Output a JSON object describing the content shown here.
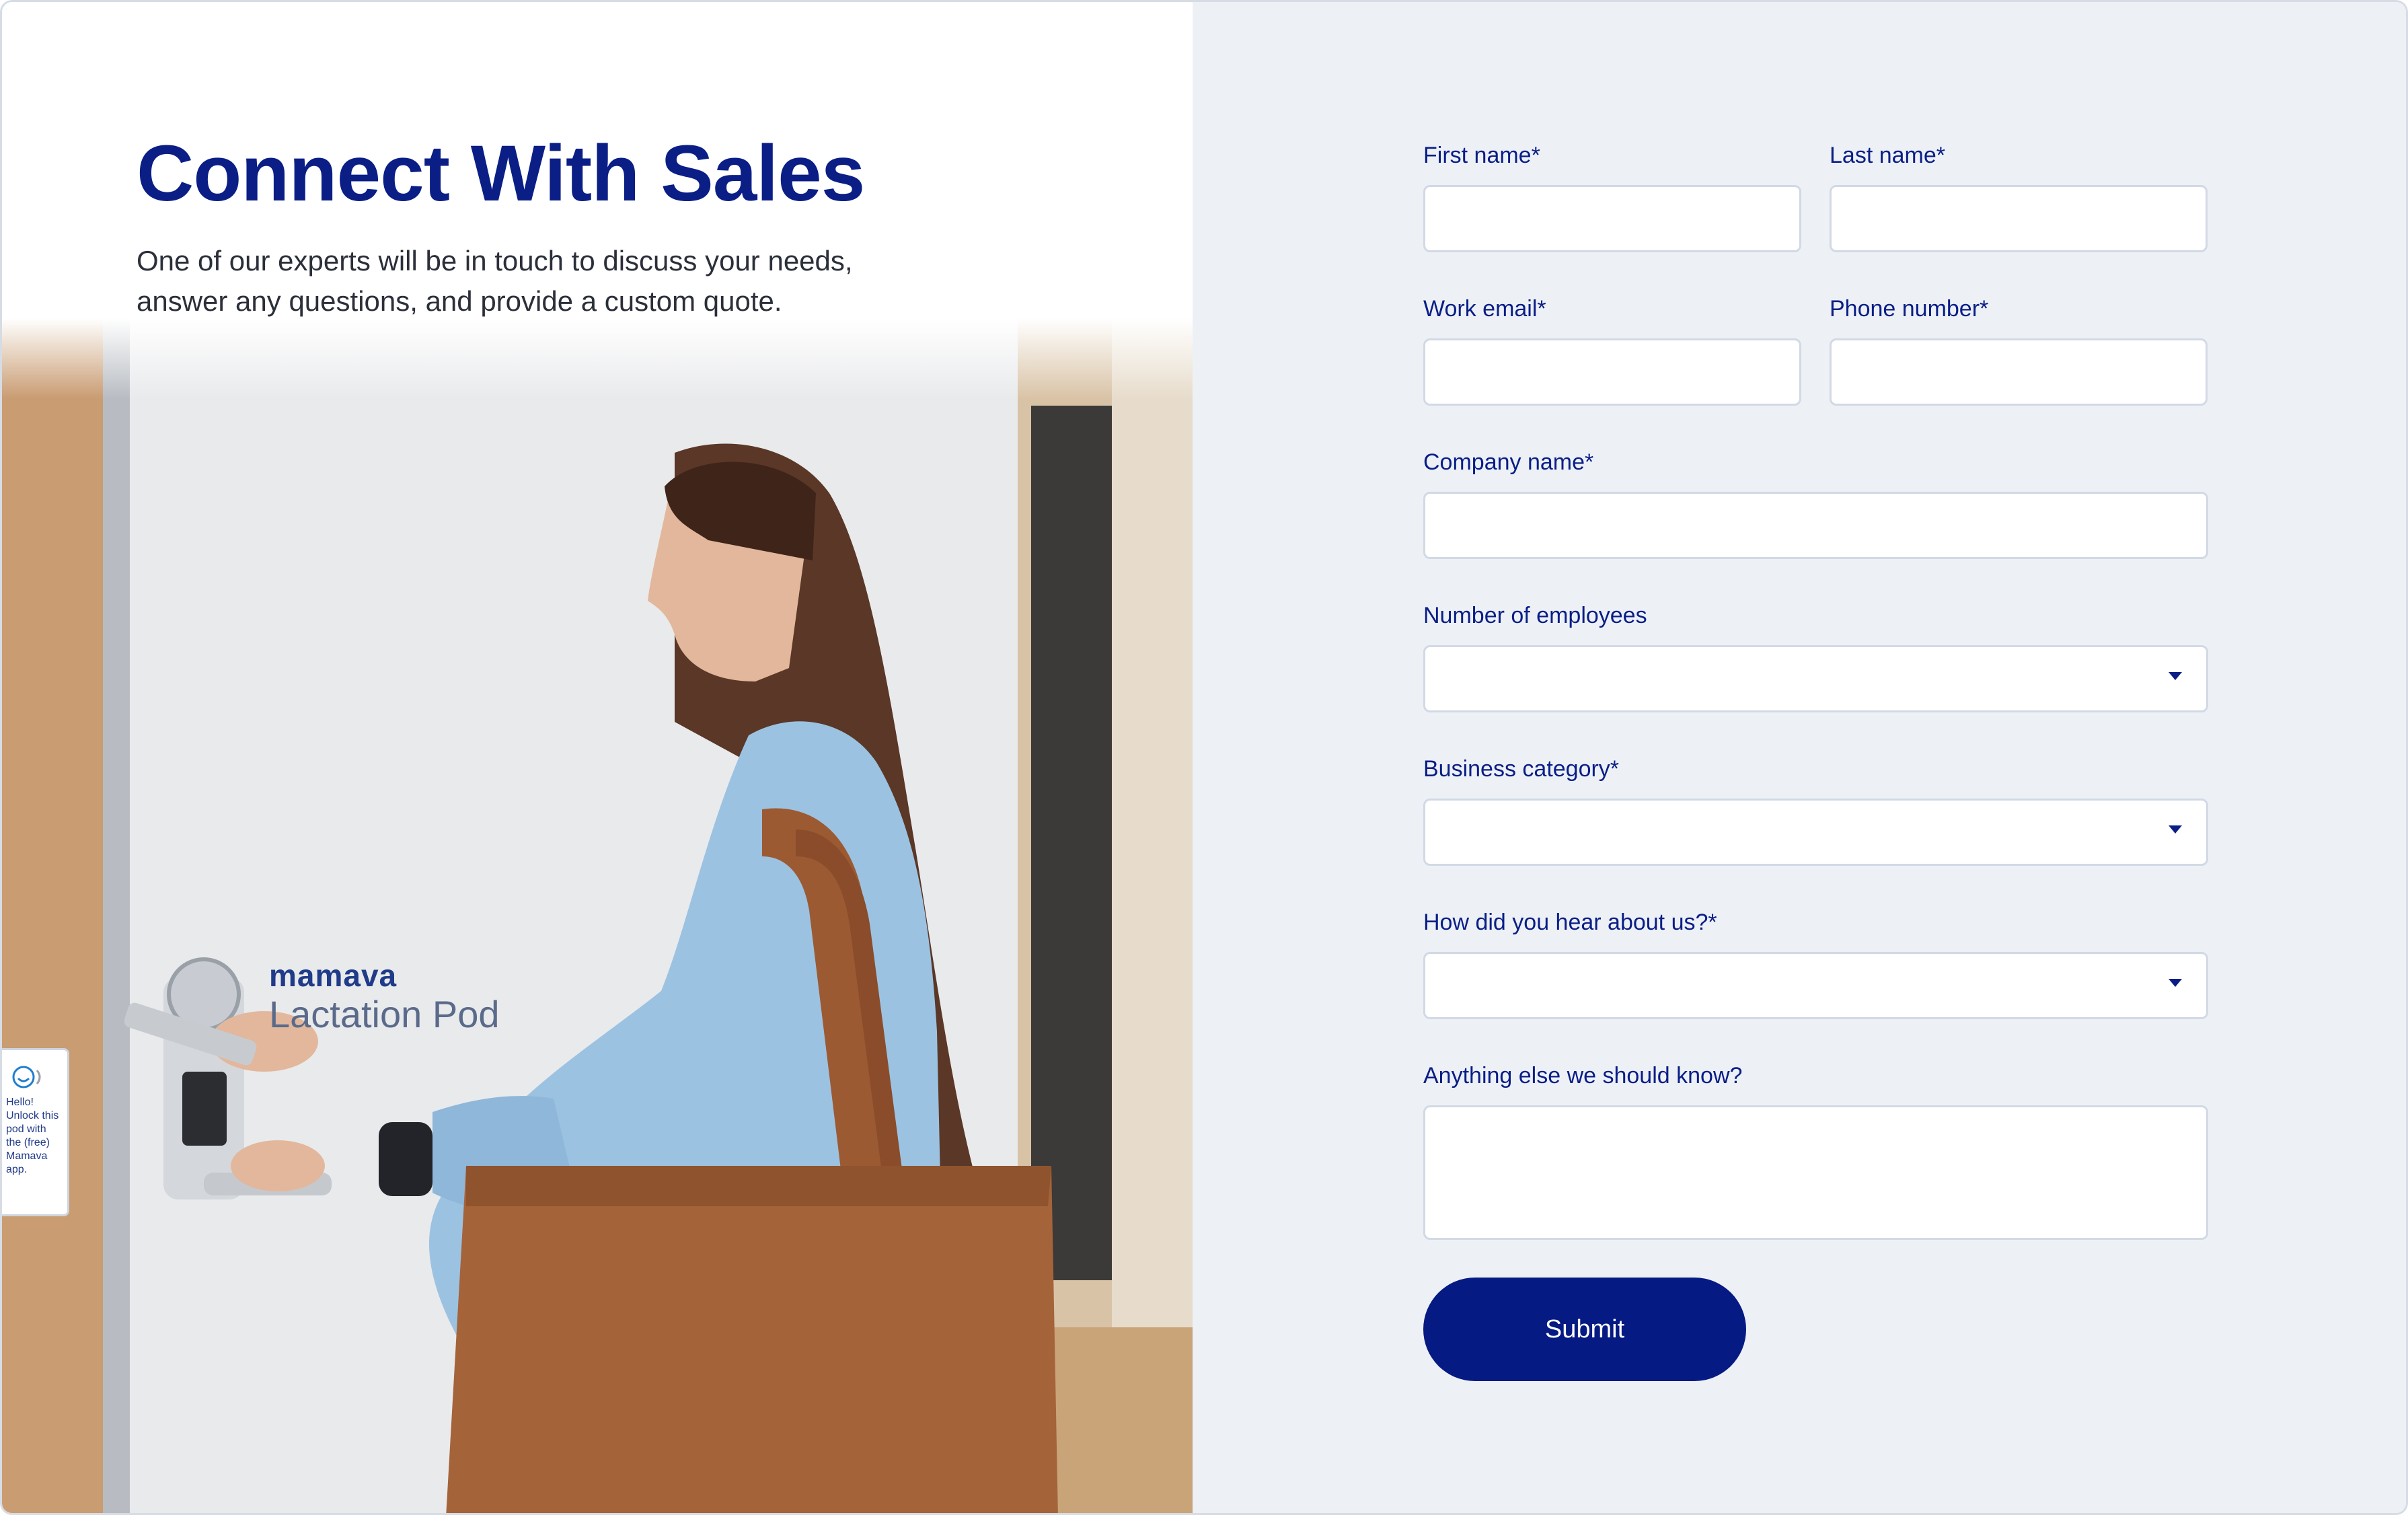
{
  "hero": {
    "title": "Connect With Sales",
    "subtitle": "One of our experts will be in touch to discuss your needs, answer any questions, and provide a custom quote.",
    "brand_name": "mamava",
    "brand_tagline": "Lactation Pod",
    "sticker_text": "Hello! Unlock this pod with the (free) Mamava app."
  },
  "form": {
    "first_name_label": "First name*",
    "last_name_label": "Last name*",
    "work_email_label": "Work email*",
    "phone_label": "Phone number*",
    "company_label": "Company name*",
    "employees_label": "Number of employees",
    "business_category_label": "Business category*",
    "hear_about_label": "How did you hear about us?*",
    "anything_else_label": "Anything else we should know?",
    "first_name_value": "",
    "last_name_value": "",
    "work_email_value": "",
    "phone_value": "",
    "company_value": "",
    "employees_value": "",
    "business_category_value": "",
    "hear_about_value": "",
    "anything_else_value": "",
    "submit_label": "Submit"
  },
  "colors": {
    "brand_navy": "#0a1e86",
    "button_navy": "#051a82",
    "form_background": "#edf1f6"
  }
}
